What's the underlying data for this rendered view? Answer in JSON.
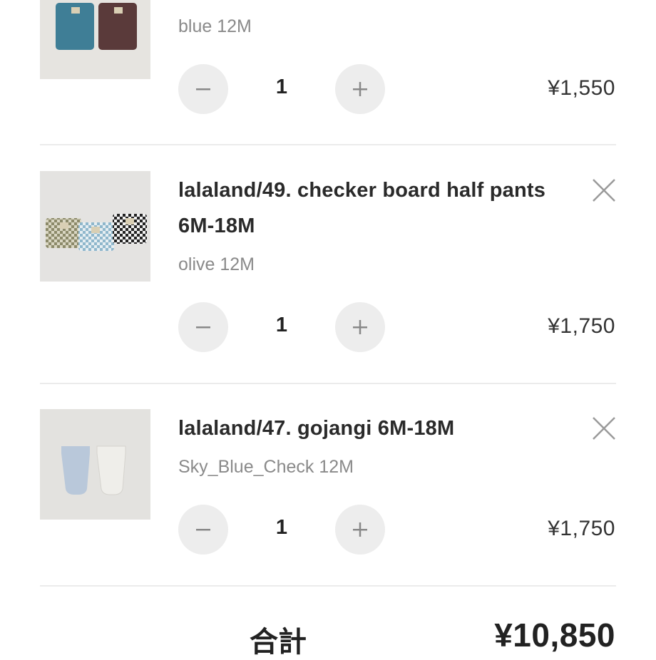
{
  "cart": {
    "items": [
      {
        "title_line1": "",
        "title_line2": "",
        "variant": "blue 12M",
        "quantity": "1",
        "price": "¥1,550"
      },
      {
        "title_line1": "lalaland/49. checker board half pants",
        "title_line2": "6M-18M",
        "variant": "olive 12M",
        "quantity": "1",
        "price": "¥1,750"
      },
      {
        "title_line1": "lalaland/47. gojangi 6M-18M",
        "title_line2": "",
        "variant": "Sky_Blue_Check 12M",
        "quantity": "1",
        "price": "¥1,750"
      }
    ],
    "icons": {
      "decrement": "minus-icon",
      "increment": "plus-icon",
      "remove": "close-icon"
    },
    "total_label": "合計",
    "total_value": "¥10,850"
  },
  "colors": {
    "background": "#ffffff",
    "stepper_bg": "#ededed",
    "variant_text": "#8a8a8a",
    "divider": "#ebebeb"
  }
}
